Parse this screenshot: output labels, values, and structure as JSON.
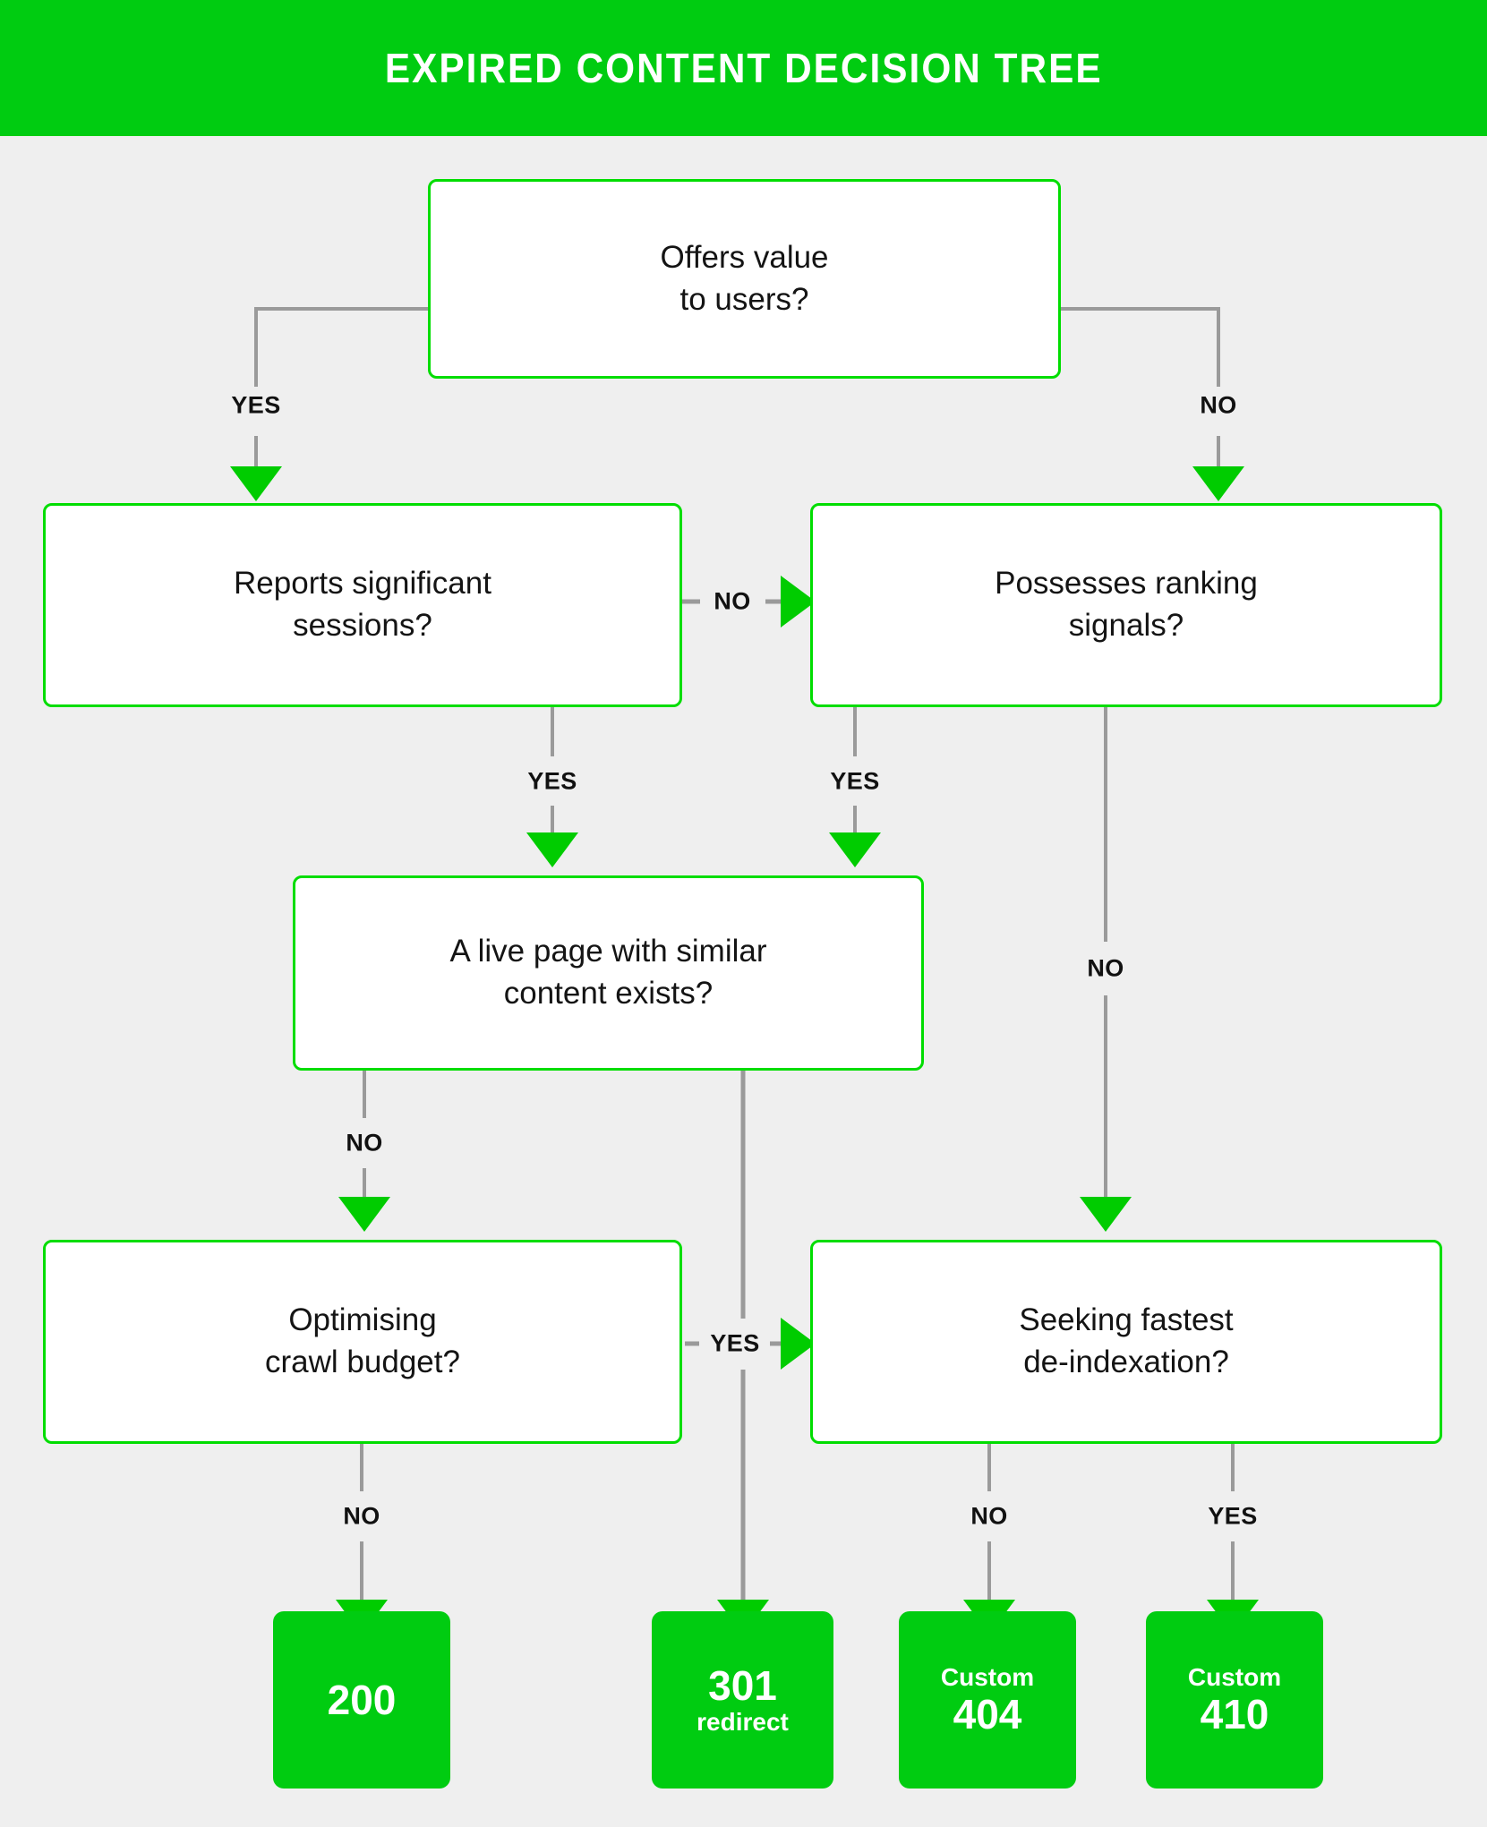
{
  "header": {
    "title": "EXPIRED CONTENT DECISION TREE"
  },
  "colors": {
    "brand_green": "#00cc11",
    "border_green": "#00dd00",
    "arrow_green": "#00cc00",
    "connector_gray": "#9a9a9a",
    "background": "#efefef",
    "text_dark": "#141414",
    "text_white": "#ffffff"
  },
  "nodes": [
    {
      "id": "offers-value",
      "label": "Offers value\nto users?"
    },
    {
      "id": "reports-sessions",
      "label": "Reports significant\nsessions?"
    },
    {
      "id": "ranking-signals",
      "label": "Possesses ranking\nsignals?"
    },
    {
      "id": "live-page",
      "label": "A live page with similar\ncontent exists?"
    },
    {
      "id": "crawl-budget",
      "label": "Optimising\ncrawl budget?"
    },
    {
      "id": "de-indexation",
      "label": "Seeking fastest\nde-indexation?"
    }
  ],
  "results": [
    {
      "id": "result-200",
      "small": "",
      "big": "200"
    },
    {
      "id": "result-301",
      "big": "301",
      "small": "redirect"
    },
    {
      "id": "result-custom-404",
      "small": "Custom",
      "big": "404"
    },
    {
      "id": "result-custom-410",
      "small": "Custom",
      "big": "410"
    }
  ],
  "edges": [
    {
      "id": "edge-offers-yes",
      "label": "YES",
      "from": "offers-value",
      "to": "reports-sessions"
    },
    {
      "id": "edge-offers-no",
      "label": "NO",
      "from": "offers-value",
      "to": "ranking-signals"
    },
    {
      "id": "edge-sessions-no",
      "label": "NO",
      "from": "reports-sessions",
      "to": "ranking-signals"
    },
    {
      "id": "edge-sessions-yes",
      "label": "YES",
      "from": "reports-sessions",
      "to": "live-page"
    },
    {
      "id": "edge-signals-yes",
      "label": "YES",
      "from": "ranking-signals",
      "to": "live-page"
    },
    {
      "id": "edge-signals-no",
      "label": "NO",
      "from": "ranking-signals",
      "to": "de-indexation"
    },
    {
      "id": "edge-livepage-no",
      "label": "NO",
      "from": "live-page",
      "to": "crawl-budget"
    },
    {
      "id": "edge-livepage-yes",
      "label": "YES",
      "from": "live-page",
      "to": "de-indexation"
    },
    {
      "id": "edge-crawl-no",
      "label": "NO",
      "from": "crawl-budget",
      "to": "result-200"
    },
    {
      "id": "edge-livepage-to-301",
      "label": "",
      "from": "live-page",
      "to": "result-301"
    },
    {
      "id": "edge-deindex-no",
      "label": "NO",
      "from": "de-indexation",
      "to": "result-custom-404"
    },
    {
      "id": "edge-deindex-yes",
      "label": "YES",
      "from": "de-indexation",
      "to": "result-custom-410"
    }
  ],
  "chart_data": {
    "type": "diagram",
    "title": "EXPIRED CONTENT DECISION TREE",
    "diagram_kind": "decision-tree-flowchart",
    "decisions": [
      "Offers value to users?",
      "Reports significant sessions?",
      "Possesses ranking signals?",
      "A live page with similar content exists?",
      "Optimising crawl budget?",
      "Seeking fastest de-indexation?"
    ],
    "outcomes": [
      "200",
      "301 redirect",
      "Custom 404",
      "Custom 410"
    ],
    "transitions": [
      {
        "from": "Offers value to users?",
        "answer": "YES",
        "to": "Reports significant sessions?"
      },
      {
        "from": "Offers value to users?",
        "answer": "NO",
        "to": "Possesses ranking signals?"
      },
      {
        "from": "Reports significant sessions?",
        "answer": "NO",
        "to": "Possesses ranking signals?"
      },
      {
        "from": "Reports significant sessions?",
        "answer": "YES",
        "to": "A live page with similar content exists?"
      },
      {
        "from": "Possesses ranking signals?",
        "answer": "YES",
        "to": "A live page with similar content exists?"
      },
      {
        "from": "Possesses ranking signals?",
        "answer": "NO",
        "to": "Seeking fastest de-indexation?"
      },
      {
        "from": "A live page with similar content exists?",
        "answer": "NO",
        "to": "Optimising crawl budget?"
      },
      {
        "from": "A live page with similar content exists?",
        "answer": "YES",
        "to": "Seeking fastest de-indexation?"
      },
      {
        "from": "A live page with similar content exists?",
        "answer": "",
        "to": "301 redirect"
      },
      {
        "from": "Optimising crawl budget?",
        "answer": "NO",
        "to": "200"
      },
      {
        "from": "Seeking fastest de-indexation?",
        "answer": "NO",
        "to": "Custom 404"
      },
      {
        "from": "Seeking fastest de-indexation?",
        "answer": "YES",
        "to": "Custom 410"
      }
    ]
  }
}
